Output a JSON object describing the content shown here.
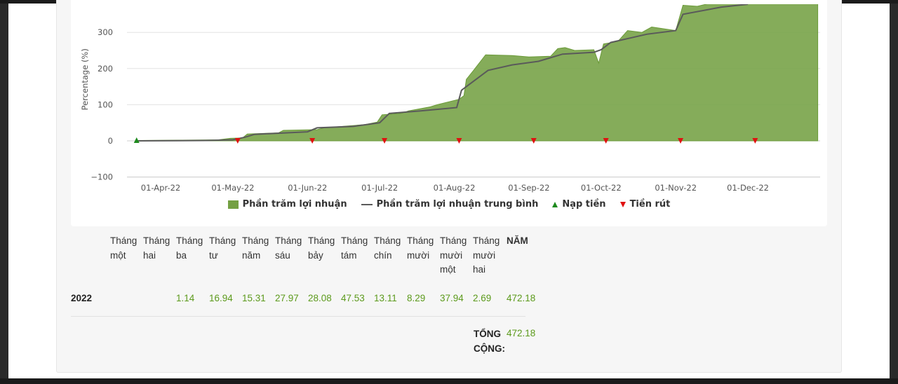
{
  "chart_data": {
    "type": "area",
    "ylabel": "Percentage (%)",
    "ylim": [
      -100,
      300
    ],
    "y_ticks": [
      "−100",
      "0",
      "100",
      "200",
      "300"
    ],
    "x_ticks": [
      "01-Apr-22",
      "01-May-22",
      "01-Jun-22",
      "01-Jul-22",
      "01-Aug-22",
      "01-Sep-22",
      "01-Oct-22",
      "01-Nov-22",
      "01-Dec-22"
    ],
    "xrange": [
      "2022-03-18",
      "2022-12-31"
    ],
    "grid": true,
    "legend_position": "bottom",
    "series": [
      {
        "name": "Phần trăm lợi nhuận",
        "kind": "area",
        "color": "#74a043",
        "points": [
          [
            "2022-03-22",
            1
          ],
          [
            "2022-04-10",
            2
          ],
          [
            "2022-04-25",
            3
          ],
          [
            "2022-04-30",
            7
          ],
          [
            "2022-05-05",
            8
          ],
          [
            "2022-05-07",
            19
          ],
          [
            "2022-05-20",
            22
          ],
          [
            "2022-05-22",
            29
          ],
          [
            "2022-06-05",
            31
          ],
          [
            "2022-06-08",
            36
          ],
          [
            "2022-06-25",
            45
          ],
          [
            "2022-06-30",
            52
          ],
          [
            "2022-07-02",
            72
          ],
          [
            "2022-07-10",
            76
          ],
          [
            "2022-07-13",
            83
          ],
          [
            "2022-07-22",
            94
          ],
          [
            "2022-07-25",
            100
          ],
          [
            "2022-08-03",
            115
          ],
          [
            "2022-08-05",
            125
          ],
          [
            "2022-08-06",
            170
          ],
          [
            "2022-08-09",
            195
          ],
          [
            "2022-08-14",
            238
          ],
          [
            "2022-08-25",
            236
          ],
          [
            "2022-09-01",
            232
          ],
          [
            "2022-09-10",
            234
          ],
          [
            "2022-09-13",
            255
          ],
          [
            "2022-09-16",
            258
          ],
          [
            "2022-09-20",
            250
          ],
          [
            "2022-09-28",
            252
          ],
          [
            "2022-09-30",
            215
          ],
          [
            "2022-10-02",
            268
          ],
          [
            "2022-10-08",
            275
          ],
          [
            "2022-10-12",
            305
          ],
          [
            "2022-10-18",
            300
          ],
          [
            "2022-10-22",
            315
          ],
          [
            "2022-11-01",
            305
          ],
          [
            "2022-11-04",
            375
          ],
          [
            "2022-11-10",
            372
          ],
          [
            "2022-11-15",
            380
          ],
          [
            "2022-12-30",
            380
          ]
        ]
      },
      {
        "name": "Phần trăm lợi nhuận trung bình",
        "kind": "line",
        "color": "#5a5a5a",
        "points": [
          [
            "2022-03-22",
            0
          ],
          [
            "2022-04-20",
            1
          ],
          [
            "2022-05-01",
            3
          ],
          [
            "2022-05-06",
            10
          ],
          [
            "2022-05-10",
            18
          ],
          [
            "2022-06-01",
            25
          ],
          [
            "2022-06-05",
            36
          ],
          [
            "2022-06-20",
            40
          ],
          [
            "2022-07-01",
            50
          ],
          [
            "2022-07-05",
            76
          ],
          [
            "2022-07-18",
            83
          ],
          [
            "2022-08-02",
            92
          ],
          [
            "2022-08-04",
            140
          ],
          [
            "2022-08-15",
            195
          ],
          [
            "2022-08-25",
            210
          ],
          [
            "2022-09-05",
            220
          ],
          [
            "2022-09-15",
            240
          ],
          [
            "2022-09-28",
            245
          ],
          [
            "2022-10-01",
            252
          ],
          [
            "2022-10-05",
            272
          ],
          [
            "2022-10-20",
            295
          ],
          [
            "2022-11-01",
            305
          ],
          [
            "2022-11-04",
            350
          ],
          [
            "2022-11-20",
            370
          ],
          [
            "2022-12-01",
            378
          ]
        ]
      }
    ],
    "deposit_markers": [
      "2022-03-22"
    ],
    "withdraw_markers": [
      "2022-05-03",
      "2022-06-03",
      "2022-07-03",
      "2022-08-03",
      "2022-09-03",
      "2022-10-03",
      "2022-11-03",
      "2022-12-04"
    ]
  },
  "legend": {
    "area": "Phần trăm lợi nhuận",
    "line": "Phần trăm lợi nhuận trung bình",
    "deposit": "Nạp tiền",
    "withdraw": "Tiền rút"
  },
  "table": {
    "months": [
      [
        "Tháng",
        "một"
      ],
      [
        "Tháng",
        "hai"
      ],
      [
        "Tháng",
        "ba"
      ],
      [
        "Tháng",
        "tư"
      ],
      [
        "Tháng",
        "năm"
      ],
      [
        "Tháng",
        "sáu"
      ],
      [
        "Tháng",
        "bảy"
      ],
      [
        "Tháng",
        "tám"
      ],
      [
        "Tháng",
        "chín"
      ],
      [
        "Tháng",
        "mười"
      ],
      [
        "Tháng",
        "mười",
        "một"
      ],
      [
        "Tháng",
        "mười",
        "hai"
      ]
    ],
    "year_header": "NĂM",
    "row": {
      "year": "2022",
      "values": [
        "",
        "",
        "1.14",
        "16.94",
        "15.31",
        "27.97",
        "28.08",
        "47.53",
        "13.11",
        "8.29",
        "37.94",
        "2.69"
      ],
      "year_total": "472.18"
    },
    "total_label": "TỔNG CỘNG:",
    "total_value": "472.18"
  },
  "colors": {
    "accent_green": "#5c9a1c",
    "area_fill": "#74a043",
    "avg_line": "#5a5a5a",
    "deposit": "#1e8a1e",
    "withdraw": "#e01010"
  }
}
